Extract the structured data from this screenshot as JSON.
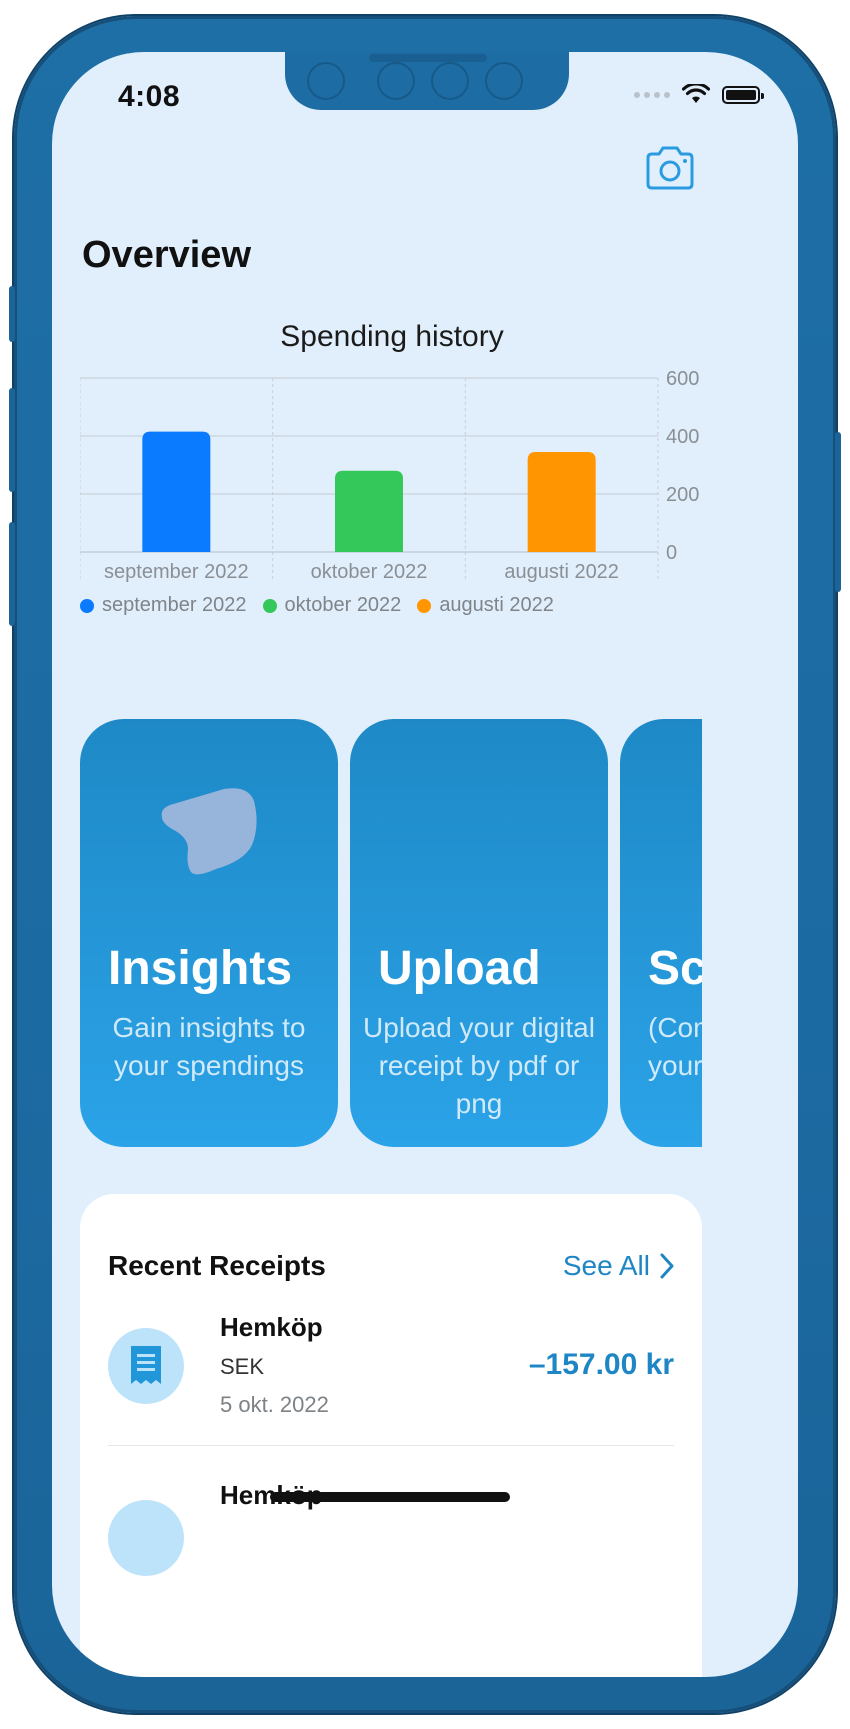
{
  "status_bar": {
    "time": "4:08"
  },
  "header": {
    "title": "Overview",
    "camera_icon": "camera-icon"
  },
  "chart_data": {
    "type": "bar",
    "title": "Spending history",
    "categories": [
      "september 2022",
      "oktober 2022",
      "augusti 2022"
    ],
    "values": [
      415,
      280,
      345
    ],
    "colors": [
      "#0a7aff",
      "#34c759",
      "#ff9500"
    ],
    "yticks": [
      0,
      200,
      400,
      600
    ],
    "ylim": [
      0,
      600
    ],
    "y_axis_side": "right",
    "legend": [
      "september 2022",
      "oktober 2022",
      "augusti 2022"
    ],
    "legend_position": "bottom"
  },
  "cards": [
    {
      "title": "Insights",
      "description": "Gain insights to your spendings"
    },
    {
      "title": "Upload",
      "description": "Upload your digital receipt by pdf or png"
    },
    {
      "title": "Scan",
      "description": "(Coming soon) Scan your physical receipt"
    }
  ],
  "receipts": {
    "title": "Recent Receipts",
    "see_all": "See All",
    "items": [
      {
        "name": "Hemköp",
        "currency": "SEK",
        "date": "5 okt. 2022",
        "amount": "–157.00 kr"
      },
      {
        "name": "Hemköp",
        "currency": "",
        "date": "",
        "amount": ""
      }
    ]
  }
}
